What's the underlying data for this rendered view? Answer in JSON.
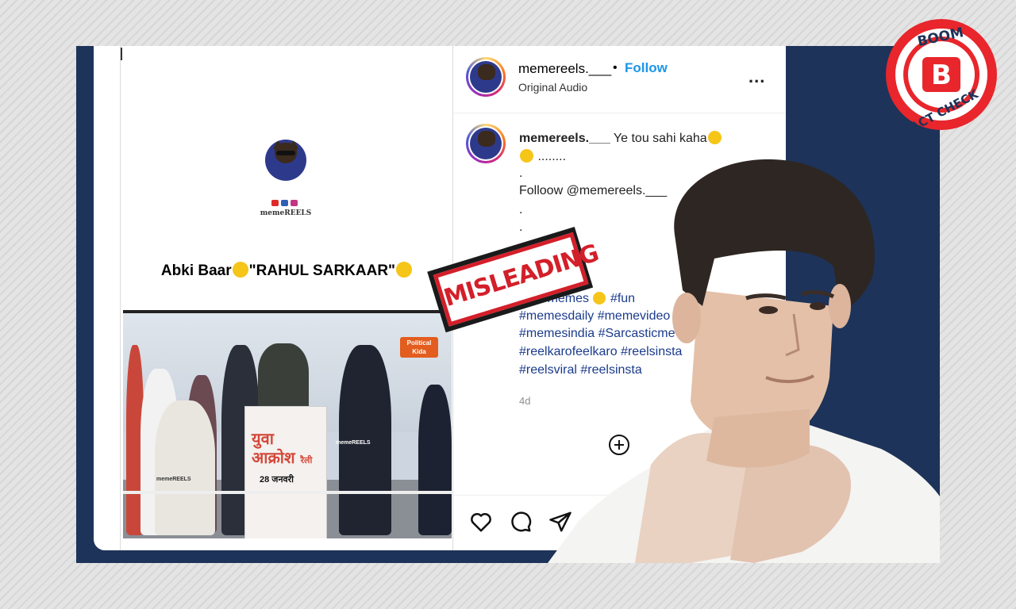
{
  "left_post": {
    "logo_text": "memeREELS",
    "caption_prefix": "Abki Baar",
    "caption_main": "\"RAHUL SARKAAR\"",
    "video": {
      "podium_text_line1": "युवा",
      "podium_text_line2": "आक्रोश",
      "podium_text_line3": "रैली",
      "podium_date": "28 जनवरी",
      "channel_badge_line1": "Political",
      "channel_badge_line2": "Kida",
      "watermark": "memeREELS"
    }
  },
  "header": {
    "username": "memereels.___",
    "separator": "•",
    "follow_label": "Follow",
    "audio_label": "Original Audio",
    "more_label": "..."
  },
  "caption": {
    "username": "memereels.___",
    "text_line1": "Ye tou sahi kaha",
    "text_line2": "........",
    "dot1": ".",
    "follow_line": "Folloow @memereels.___",
    "dot2": ".",
    "dot3": ".",
    "dot4": ".",
    "hashtags_line1": "#memes #memesdaily",
    "hashtags_line1_visible": "am #memes",
    "hashtags_line1_tail": "#fun",
    "hashtags_line2": "#memesdaily #memevideo",
    "hashtags_line3": "#memesindia #Sarcasticme",
    "hashtags_line4": "#reelkarofeelkaro #reelsinsta",
    "hashtags_line5": "#reelsviral #reelsinsta",
    "time": "4d"
  },
  "stamp": {
    "label": "MISLEADING"
  },
  "boom_badge": {
    "top": "BOOM",
    "letter": "B",
    "bottom": "FACT CHECK"
  },
  "colors": {
    "navy": "#1d3359",
    "follow_blue": "#1c96e8",
    "stamp_red": "#d31f2a",
    "boom_red": "#e8262b"
  }
}
